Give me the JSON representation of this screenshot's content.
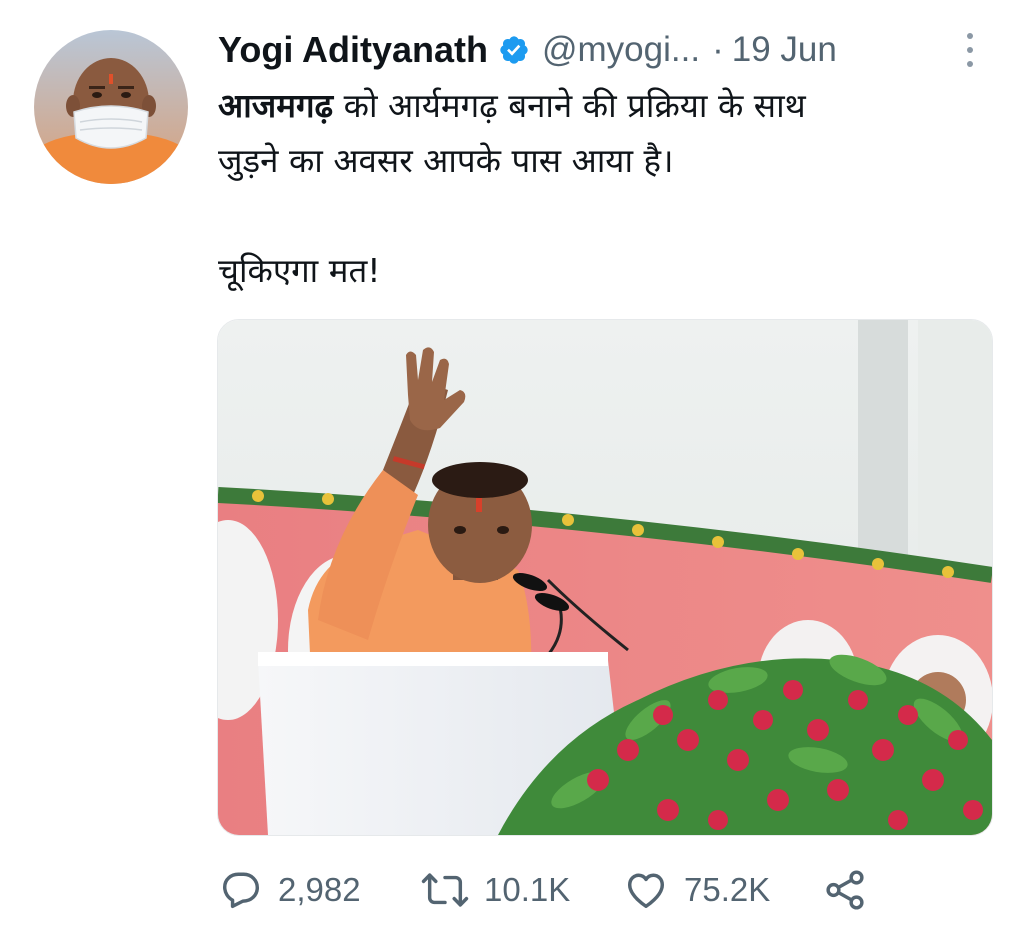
{
  "author": {
    "display_name": "Yogi Adityanath",
    "handle": "@myogi...",
    "separator": "·",
    "timestamp": "19 Jun",
    "verified_icon": "verified-badge-icon",
    "avatar": "profile-photo"
  },
  "tweet": {
    "hashtag": "आजमगढ़",
    "line1_rest": " को आर्यमगढ़ बनाने की प्रक्रिया के साथ",
    "line2": "जुड़ने का अवसर आपके पास आया है।",
    "line3": "चूकिएगा मत!"
  },
  "actions": {
    "reply": {
      "icon": "reply-icon",
      "count": "2,982"
    },
    "retweet": {
      "icon": "retweet-icon",
      "count": "10.1K"
    },
    "like": {
      "icon": "heart-icon",
      "count": "75.2K"
    },
    "share": {
      "icon": "share-icon"
    }
  },
  "colors": {
    "text_primary": "#0f1419",
    "text_secondary": "#536471",
    "verified_blue": "#1d9bf0"
  }
}
